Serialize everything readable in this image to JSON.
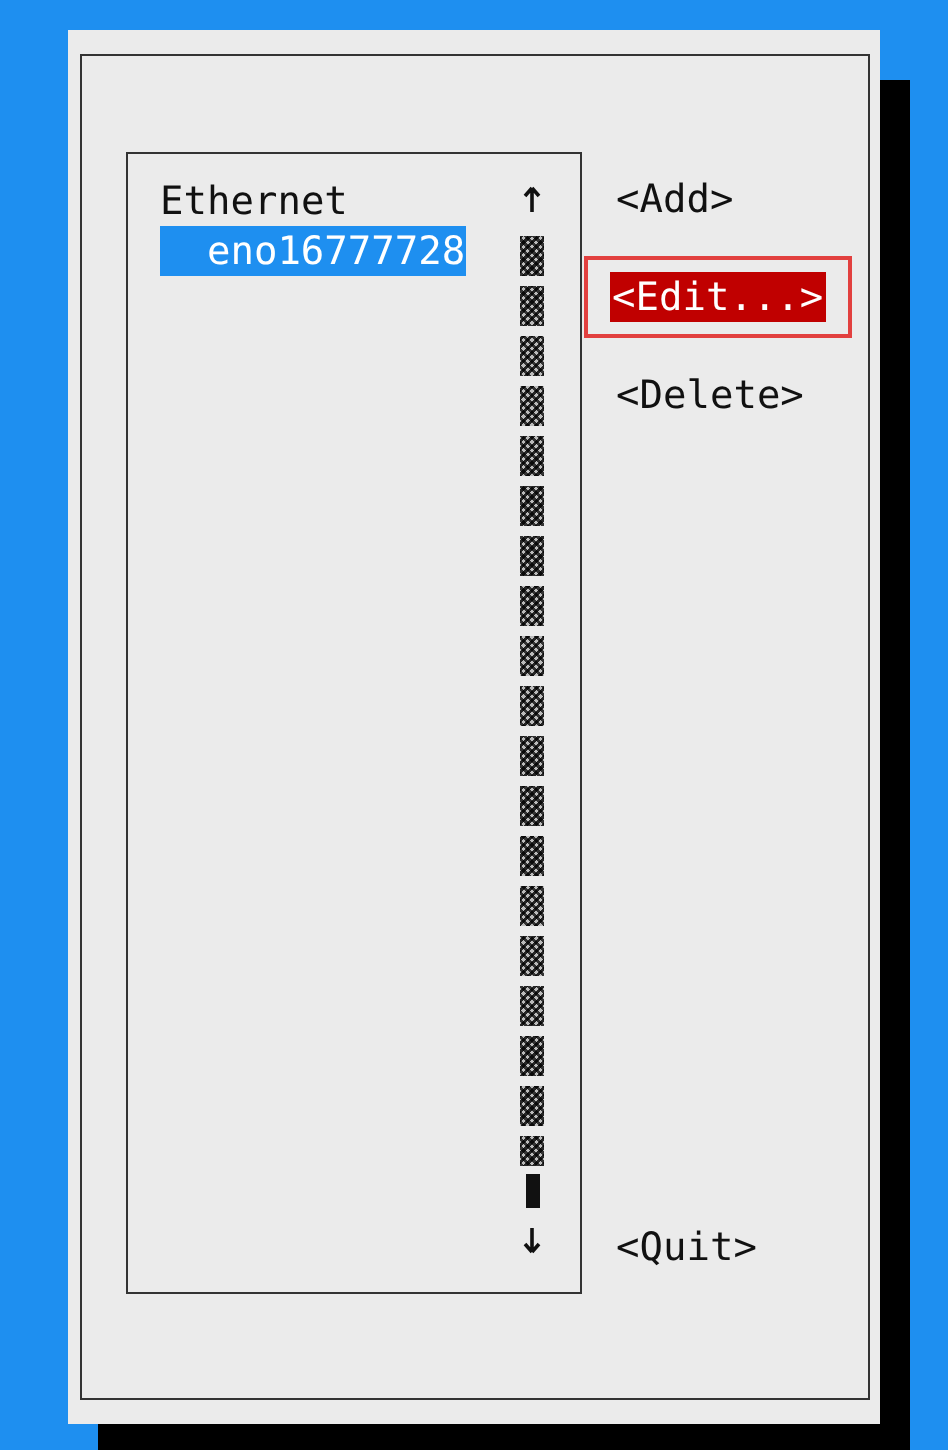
{
  "connections": [
    {
      "label": "Ethernet",
      "selected": false,
      "children": [
        {
          "label": "eno16777728",
          "selected": true
        }
      ]
    }
  ],
  "buttons": [
    {
      "label": "<Add>",
      "focused": false,
      "annotated": false
    },
    {
      "label": "<Edit...>",
      "focused": true,
      "annotated": true
    },
    {
      "label": "<Delete>",
      "focused": false,
      "annotated": false
    },
    {
      "label": "<Quit>",
      "focused": false,
      "annotated": false
    }
  ]
}
